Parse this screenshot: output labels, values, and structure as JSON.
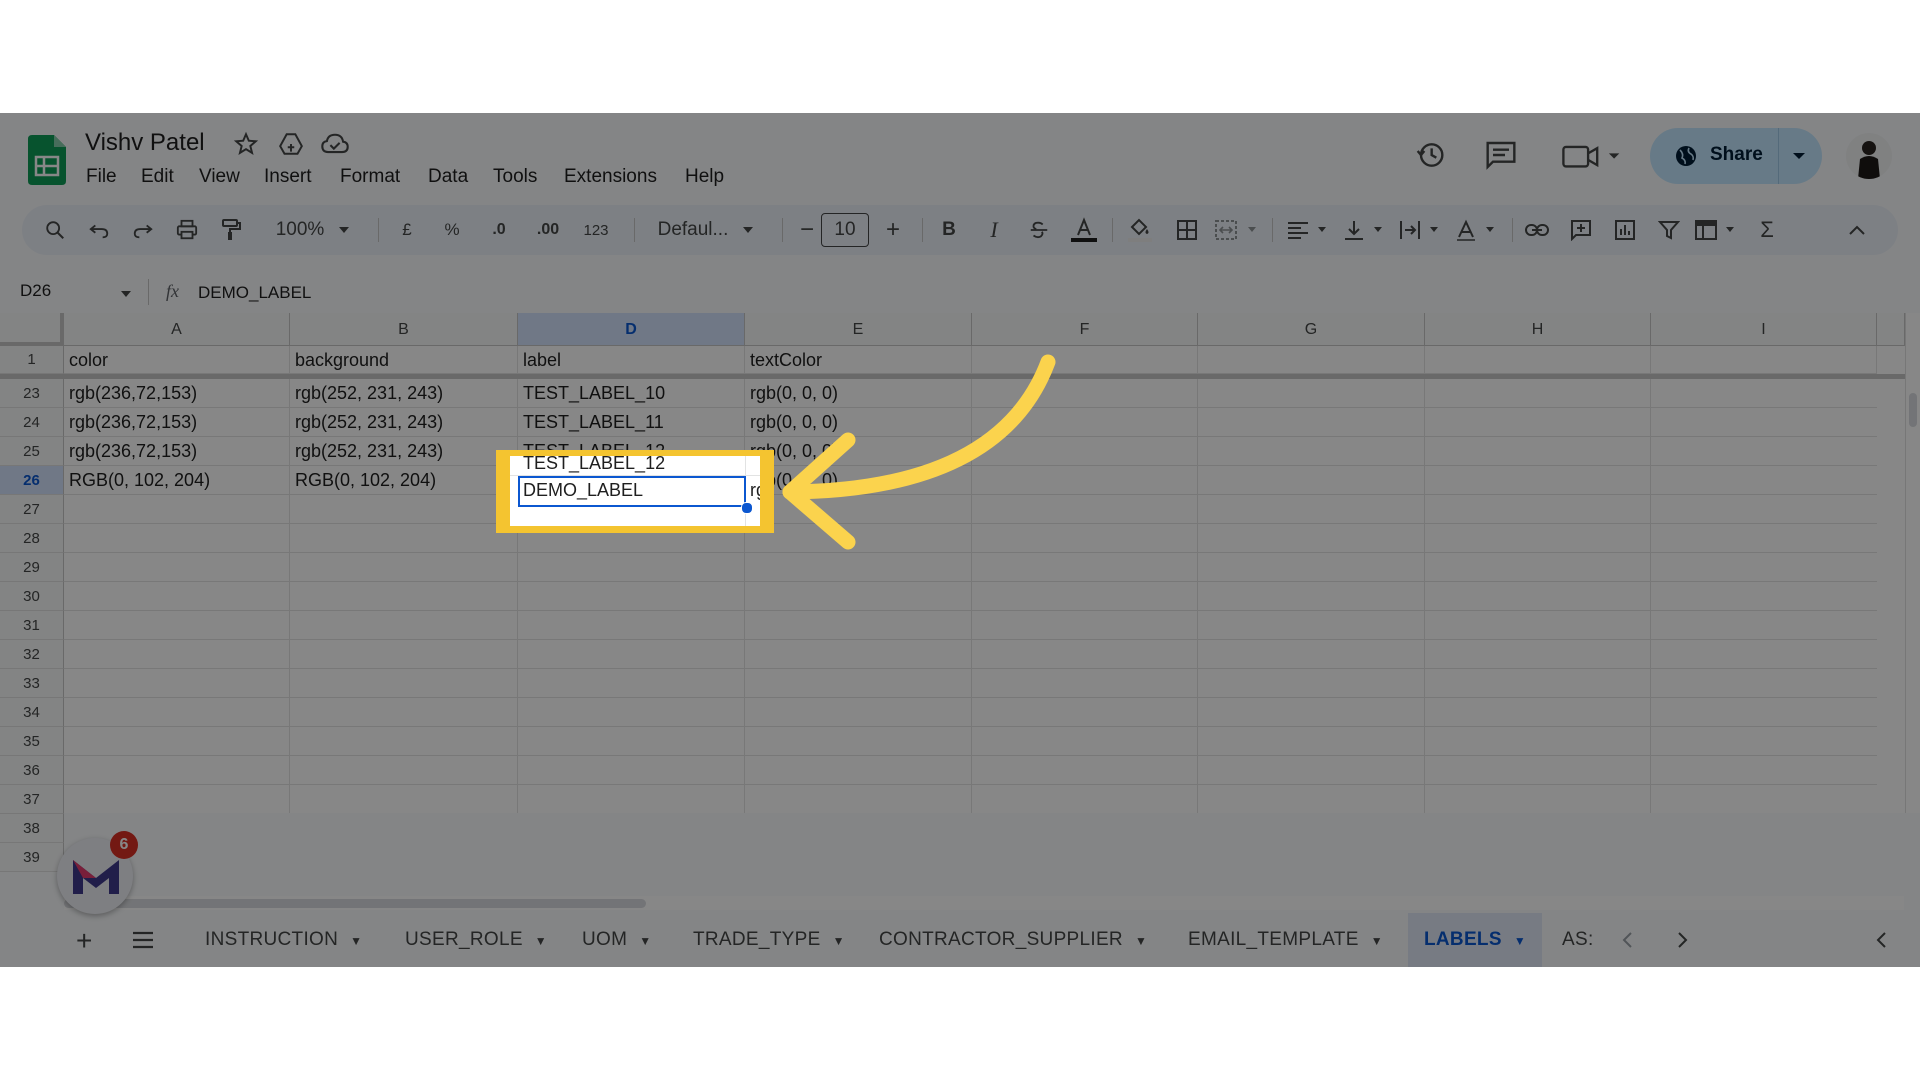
{
  "header": {
    "doc_title": "Vishv Patel",
    "menu": [
      "File",
      "Edit",
      "View",
      "Insert",
      "Format",
      "Data",
      "Tools",
      "Extensions",
      "Help"
    ],
    "share_label": "Share"
  },
  "toolbar": {
    "zoom": "100%",
    "currency": "£",
    "percent": "%",
    "dec_decrease": ".0",
    "dec_increase": ".00",
    "number_format": "123",
    "font": "Defaul...",
    "font_size": "10",
    "bold": "B",
    "italic": "I"
  },
  "formula_bar": {
    "cell_ref": "D26",
    "fx": "fx",
    "value": "DEMO_LABEL"
  },
  "columns": [
    "A",
    "B",
    "D",
    "E",
    "F",
    "G",
    "H",
    "I"
  ],
  "selected_column": "D",
  "header_row": {
    "num": "1",
    "cells": [
      "color",
      "background",
      "label",
      "textColor"
    ]
  },
  "rows": [
    {
      "num": "23",
      "cells": [
        "rgb(236,72,153)",
        "rgb(252, 231, 243)",
        "TEST_LABEL_10",
        "rgb(0, 0, 0)"
      ]
    },
    {
      "num": "24",
      "cells": [
        "rgb(236,72,153)",
        "rgb(252, 231, 243)",
        "TEST_LABEL_11",
        "rgb(0, 0, 0)"
      ]
    },
    {
      "num": "25",
      "cells": [
        "rgb(236,72,153)",
        "rgb(252, 231, 243)",
        "TEST_LABEL_12",
        "rgb(0, 0, 0)"
      ]
    },
    {
      "num": "26",
      "cells": [
        "RGB(0, 102, 204)",
        "RGB(0, 102, 204)",
        "DEMO_LABEL",
        "rgb(0, 0, 0)"
      ]
    }
  ],
  "empty_rows": [
    "27",
    "28",
    "29",
    "30",
    "31",
    "32",
    "33",
    "34",
    "35",
    "36",
    "37",
    "38",
    "39"
  ],
  "sheet_tabs": {
    "items": [
      "INSTRUCTION",
      "USER_ROLE",
      "UOM",
      "TRADE_TYPE",
      "CONTRACTOR_SUPPLIER",
      "EMAIL_TEMPLATE",
      "LABELS",
      "AS:"
    ],
    "active": "LABELS"
  },
  "badge": {
    "count": "6"
  },
  "colors": {
    "highlight": "#f4c430",
    "arrow": "#fbd34d",
    "selection": "#0b57d0",
    "sheets_green": "#0f9d58"
  },
  "icons": [
    "sheets-logo-icon",
    "star-icon",
    "drive-icon",
    "cloud-icon",
    "history-icon",
    "comment-icon",
    "meet-icon",
    "globe-icon",
    "search-icon",
    "undo-icon",
    "redo-icon",
    "print-icon",
    "paint-format-icon"
  ]
}
